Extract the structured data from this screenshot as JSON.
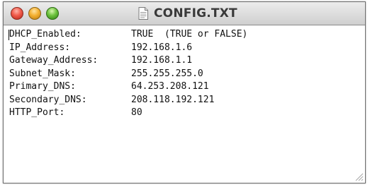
{
  "window": {
    "title": "CONFIG.TXT",
    "title_icon": "text-document-icon",
    "controls": [
      "close",
      "minimize",
      "zoom"
    ],
    "colors": {
      "close": "#f05a4a",
      "minimize": "#f4b030",
      "zoom": "#6cc23c"
    }
  },
  "file": {
    "lines": [
      {
        "key": "DHCP_Enabled:",
        "value": "TRUE  (TRUE or FALSE)"
      },
      {
        "key": "IP_Address:",
        "value": "192.168.1.6"
      },
      {
        "key": "Gateway_Address:",
        "value": "192.168.1.1"
      },
      {
        "key": "Subnet_Mask:",
        "value": "255.255.255.0"
      },
      {
        "key": "Primary_DNS:",
        "value": "64.253.208.121"
      },
      {
        "key": "Secondary_DNS:",
        "value": "208.118.192.121"
      },
      {
        "key": "HTTP_Port:",
        "value": "80"
      }
    ]
  }
}
